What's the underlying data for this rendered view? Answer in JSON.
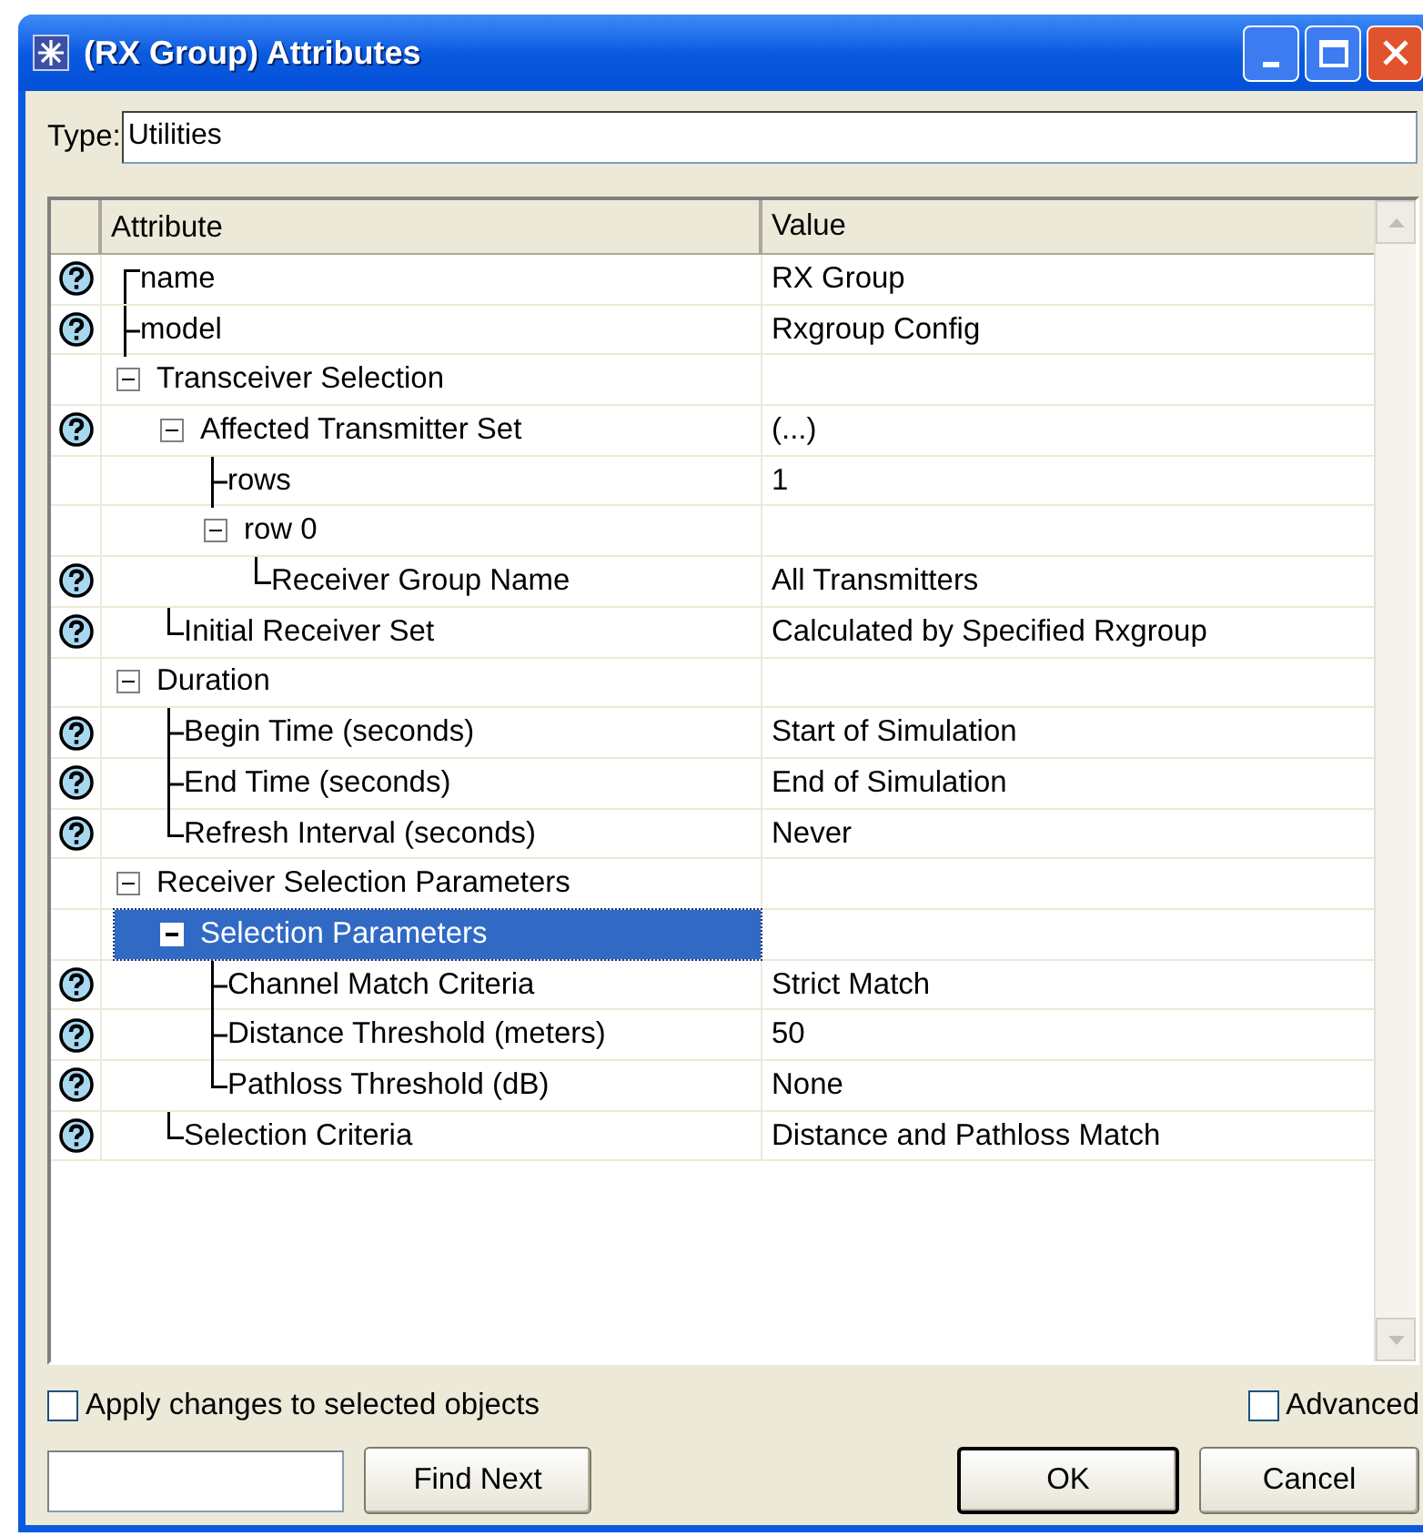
{
  "window": {
    "title": "(RX Group) Attributes"
  },
  "type_field": {
    "label": "Type:",
    "value": "Utilities"
  },
  "table": {
    "columns": [
      "Attribute",
      "Value"
    ],
    "rows": [
      {
        "attribute": "name",
        "value": "RX Group",
        "help": true,
        "selected": false
      },
      {
        "attribute": "model",
        "value": "Rxgroup Config",
        "help": true,
        "selected": false
      },
      {
        "attribute": "Transceiver Selection",
        "help": false,
        "expanded": true,
        "selected": false,
        "children": [
          {
            "attribute": "Affected Transmitter Set",
            "value": "(...)",
            "help": true,
            "expanded": true,
            "selected": false,
            "children": [
              {
                "attribute": "rows",
                "value": "1",
                "help": false,
                "selected": false
              },
              {
                "attribute": "row 0",
                "help": false,
                "expanded": true,
                "selected": false,
                "children": [
                  {
                    "attribute": "Receiver Group Name",
                    "value": "All Transmitters",
                    "help": true,
                    "selected": false
                  }
                ]
              }
            ]
          },
          {
            "attribute": "Initial Receiver Set",
            "value": "Calculated by Specified Rxgroup",
            "help": true,
            "selected": false
          }
        ]
      },
      {
        "attribute": "Duration",
        "help": false,
        "expanded": true,
        "selected": false,
        "children": [
          {
            "attribute": "Begin Time (seconds)",
            "value": "Start of Simulation",
            "help": true,
            "selected": false
          },
          {
            "attribute": "End Time (seconds)",
            "value": "End of Simulation",
            "help": true,
            "selected": false
          },
          {
            "attribute": "Refresh Interval (seconds)",
            "value": "Never",
            "help": true,
            "selected": false
          }
        ]
      },
      {
        "attribute": "Receiver Selection Parameters",
        "help": false,
        "expanded": true,
        "selected": false,
        "children": [
          {
            "attribute": "Selection Parameters",
            "help": false,
            "expanded": true,
            "selected": true,
            "children": [
              {
                "attribute": "Channel Match Criteria",
                "value": "Strict Match",
                "help": true,
                "selected": false
              },
              {
                "attribute": "Distance Threshold (meters)",
                "value": "50",
                "help": true,
                "selected": false
              },
              {
                "attribute": "Pathloss Threshold (dB)",
                "value": "None",
                "help": true,
                "selected": false
              }
            ]
          },
          {
            "attribute": "Selection Criteria",
            "value": "Distance and Pathloss Match",
            "help": true,
            "selected": false
          }
        ]
      }
    ]
  },
  "apply_checkbox": {
    "label": "Apply changes to selected objects",
    "checked": false
  },
  "advanced_checkbox": {
    "label": "Advanced",
    "checked": false
  },
  "buttons": [
    {
      "label": "Find Next",
      "default": false
    },
    {
      "label": "OK",
      "default": true
    },
    {
      "label": "Cancel",
      "default": false
    }
  ]
}
